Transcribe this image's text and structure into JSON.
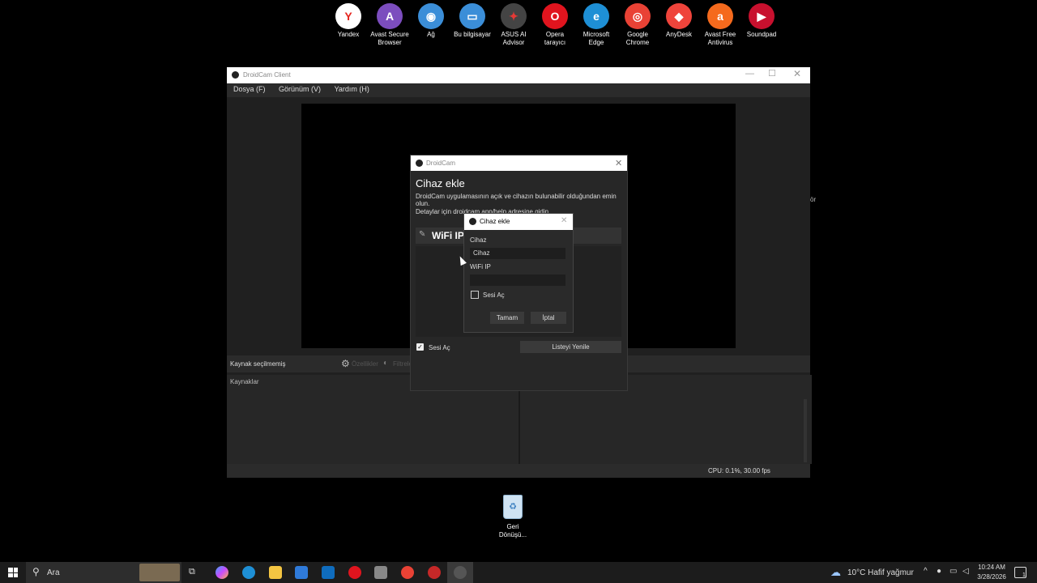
{
  "desktop": {
    "icons": [
      {
        "label": "Yandex",
        "color": "#ffffff",
        "glyph": "Y",
        "fg": "#e52620"
      },
      {
        "label": "Avast Secure Browser",
        "color": "#7c4dbe",
        "glyph": "A",
        "fg": "#ffffff"
      },
      {
        "label": "Ağ",
        "color": "#3b8ed8",
        "glyph": "◉",
        "fg": "#ffffff"
      },
      {
        "label": "Bu bilgisayar",
        "color": "#3b8ed8",
        "glyph": "▭",
        "fg": "#ffffff"
      },
      {
        "label": "ASUS AI Advisor",
        "color": "#444444",
        "glyph": "✦",
        "fg": "#e53935"
      },
      {
        "label": "Opera tarayıcı",
        "color": "#e0141e",
        "glyph": "O",
        "fg": "#ffffff"
      },
      {
        "label": "Microsoft Edge",
        "color": "#1e8fd5",
        "glyph": "e",
        "fg": "#ffffff"
      },
      {
        "label": "Google Chrome",
        "color": "#e94235",
        "glyph": "◎",
        "fg": "#ffffff"
      },
      {
        "label": "AnyDesk",
        "color": "#ef443b",
        "glyph": "◆",
        "fg": "#ffffff"
      },
      {
        "label": "Avast Free Antivirus",
        "color": "#f56a1d",
        "glyph": "a",
        "fg": "#ffffff"
      },
      {
        "label": "Soundpad",
        "color": "#c8102e",
        "glyph": "▶",
        "fg": "#ffffff"
      }
    ],
    "recycle_bin": "Geri Dönüşü..."
  },
  "main_window": {
    "title": "DroidCam Client",
    "menu": [
      "Dosya (F)",
      "Görünüm (V)",
      "Yardım (H)"
    ],
    "no_source": "Kaynak seçilmemiş",
    "properties": "Özellikler",
    "filters": "Filtreler",
    "sources_header": "Kaynaklar",
    "status": "CPU: 0.1%, 30.00 fps",
    "edge_text": "ör"
  },
  "droidcam_dialog": {
    "title": "DroidCam",
    "heading": "Cihaz ekle",
    "description": "DroidCam uygulamasının açık ve cihazın bulunabilir olduğundan emin olun.",
    "details": "Detaylar için droidcam.app/help adresine gidin.",
    "wifi_label": "WiFi IP",
    "audio_label": "Sesi Aç",
    "refresh_button": "Listeyi Yenile"
  },
  "add_device_dialog": {
    "title": "Cihaz ekle",
    "device_label": "Cihaz",
    "device_value": "Cihaz",
    "wifi_label": "WiFi IP",
    "wifi_value": "",
    "audio_label": "Sesi Aç",
    "ok_button": "Tamam",
    "cancel_button": "İptal"
  },
  "taskbar": {
    "search_placeholder": "Ara",
    "weather": "10°C  Hafif yağmur",
    "time": "10:24 AM",
    "date": "3/28/2026",
    "notification_count": "1"
  }
}
